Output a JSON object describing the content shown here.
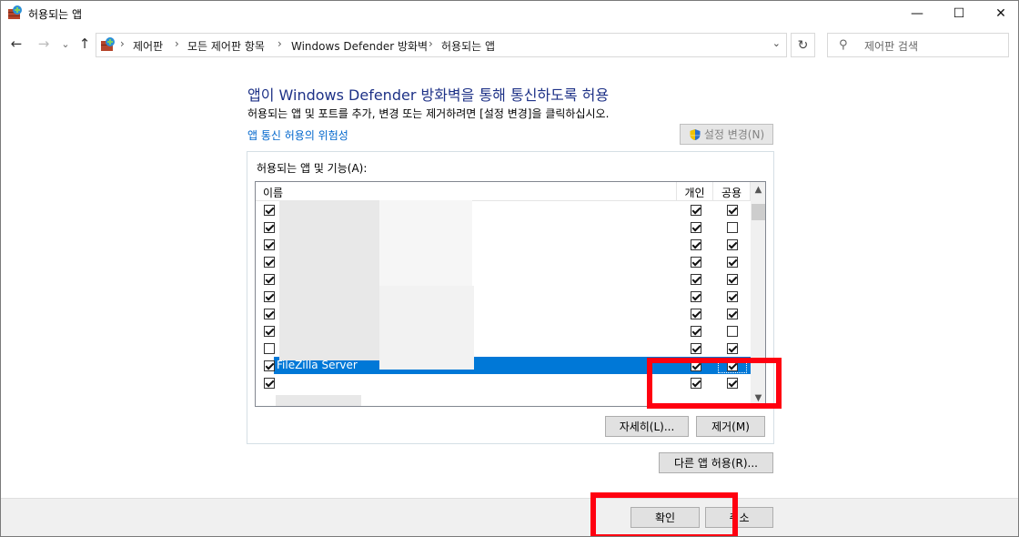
{
  "titlebar": {
    "title": "허용되는 앱",
    "minimize": "—",
    "maximize": "☐",
    "close": "✕"
  },
  "nav": {
    "back": "←",
    "forward": "→",
    "recent": "⌄",
    "up": "↑",
    "breadcrumbs": [
      "제어판",
      "모든 제어판 항목",
      "Windows Defender 방화벽",
      "허용되는 앱"
    ],
    "separator": "›",
    "dropdown": "⌄",
    "refresh": "↻",
    "search_placeholder": "제어판 검색",
    "search_icon": "⚲"
  },
  "main": {
    "heading": "앱이 Windows Defender 방화벽을 통해 통신하도록 허용",
    "subtext": "허용되는 앱 및 포트를 추가, 변경 또는 제거하려면 [설정 변경]을 클릭하십시오.",
    "risk_link": "앱 통신 허용의 위험성",
    "change_settings": "설정 변경(N)",
    "group_label": "허용되는 앱 및 기능(A):",
    "columns": {
      "name": "이름",
      "private": "개인",
      "public": "공용"
    },
    "rows": [
      {
        "enabled": true,
        "name": "",
        "private": true,
        "public": true
      },
      {
        "enabled": true,
        "name": "",
        "private": true,
        "public": false
      },
      {
        "enabled": true,
        "name": "",
        "private": true,
        "public": true
      },
      {
        "enabled": true,
        "name": "",
        "private": true,
        "public": true
      },
      {
        "enabled": true,
        "name": "",
        "private": true,
        "public": true
      },
      {
        "enabled": true,
        "name": "",
        "private": true,
        "public": true
      },
      {
        "enabled": true,
        "name": "",
        "private": true,
        "public": true
      },
      {
        "enabled": true,
        "name": "",
        "private": true,
        "public": false
      },
      {
        "enabled": false,
        "name": "",
        "private": true,
        "public": true
      },
      {
        "enabled": true,
        "name": "FileZilla Server",
        "private": true,
        "public": true,
        "selected": true
      },
      {
        "enabled": true,
        "name": "",
        "private": true,
        "public": true
      }
    ],
    "details_button": "자세히(L)...",
    "remove_button": "제거(M)",
    "allow_other_button": "다른 앱 허용(R)..."
  },
  "footer": {
    "ok_button": "확인",
    "cancel_button": "취소"
  },
  "colors": {
    "heading": "#1e3287",
    "link": "#0066cc",
    "selection": "#0078d7",
    "annotation": "#ff0010"
  }
}
